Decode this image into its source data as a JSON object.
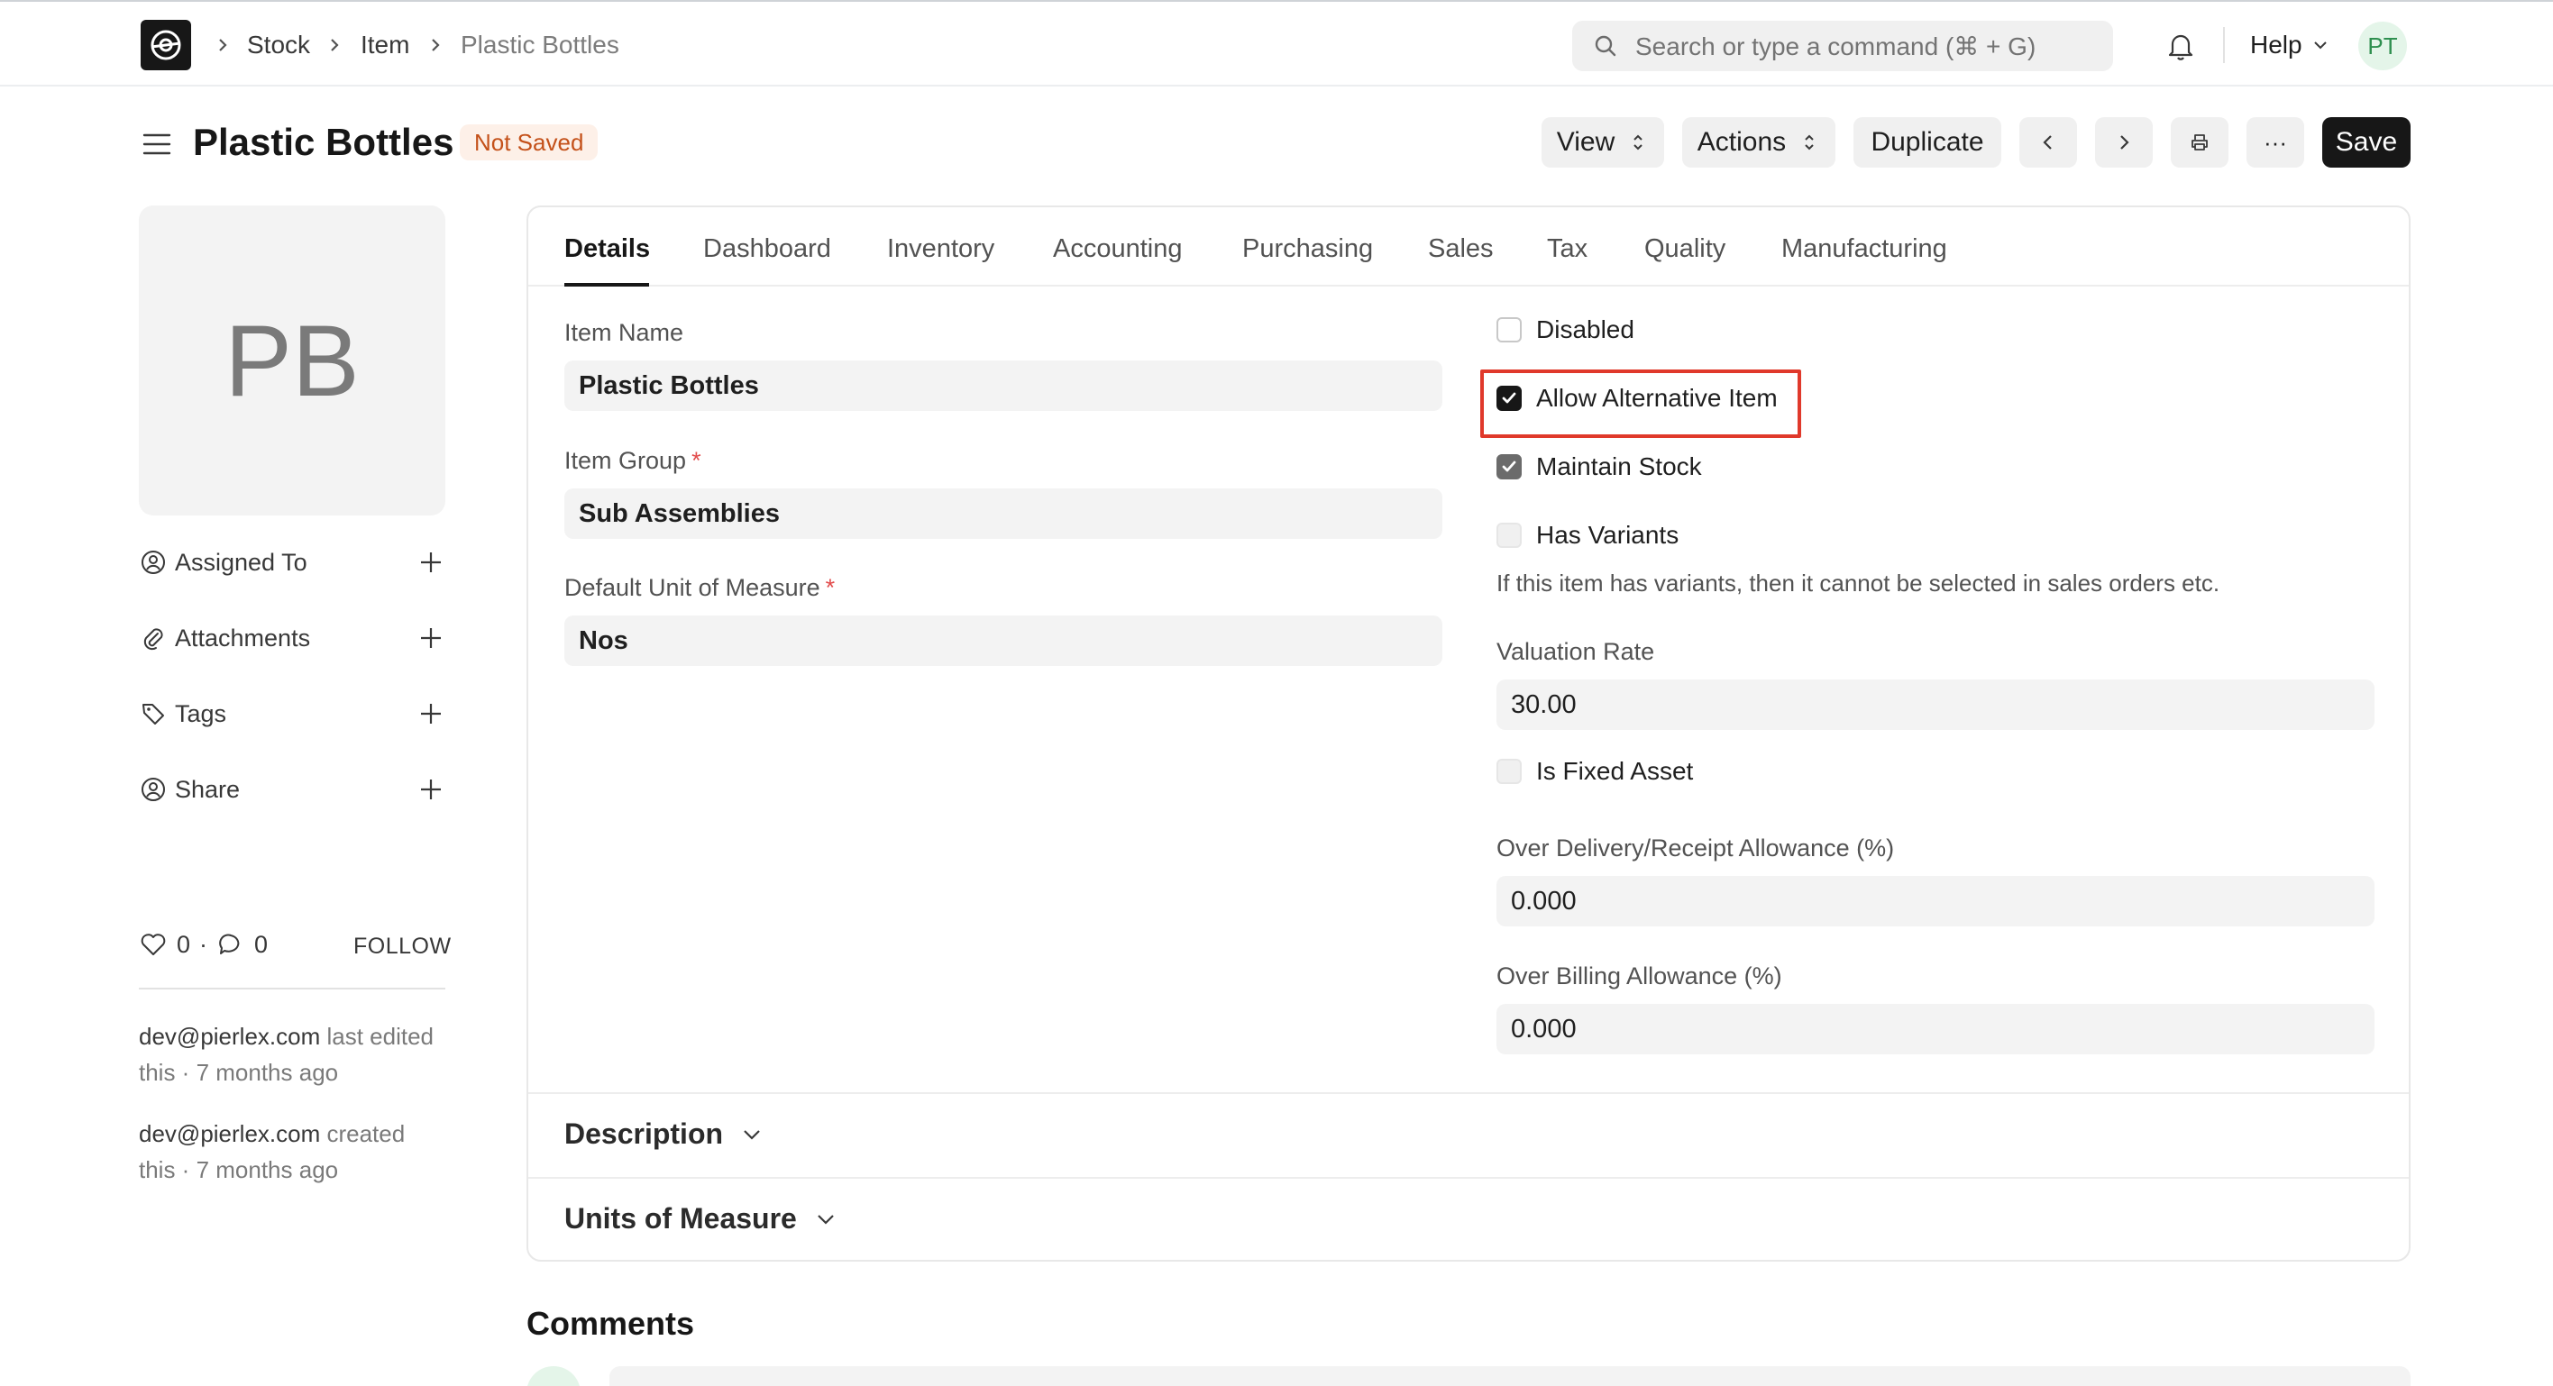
{
  "navbar": {
    "breadcrumbs": [
      "Stock",
      "Item",
      "Plastic Bottles"
    ],
    "search_placeholder": "Search or type a command (⌘ + G)",
    "help_label": "Help",
    "user_initials": "PT"
  },
  "page": {
    "title": "Plastic Bottles",
    "status_badge": "Not Saved",
    "buttons": {
      "view": "View",
      "actions": "Actions",
      "duplicate": "Duplicate",
      "more": "···",
      "save": "Save"
    }
  },
  "sidebar": {
    "avatar_initials": "PB",
    "items": [
      {
        "label": "Assigned To",
        "icon": "assign-icon"
      },
      {
        "label": "Attachments",
        "icon": "paperclip-icon"
      },
      {
        "label": "Tags",
        "icon": "tag-icon"
      },
      {
        "label": "Share",
        "icon": "share-user-icon"
      }
    ],
    "likes_count": "0",
    "comments_count": "0",
    "follow_label": "FOLLOW",
    "activity": [
      {
        "user": "dev@pierlex.com",
        "text": " last edited this · 7 months ago"
      },
      {
        "user": "dev@pierlex.com",
        "text": " created this · 7 months ago"
      }
    ]
  },
  "tabs": [
    "Details",
    "Dashboard",
    "Inventory",
    "Accounting",
    "Purchasing",
    "Sales",
    "Tax",
    "Quality",
    "Manufacturing"
  ],
  "active_tab": "Details",
  "form": {
    "item_name": {
      "label": "Item Name",
      "value": "Plastic Bottles"
    },
    "item_group": {
      "label": "Item Group",
      "required": "*",
      "value": "Sub Assemblies"
    },
    "uom": {
      "label": "Default Unit of Measure",
      "required": "*",
      "value": "Nos"
    },
    "disabled": {
      "label": "Disabled",
      "checked": false
    },
    "allow_alternative_item": {
      "label": "Allow Alternative Item",
      "checked": true
    },
    "maintain_stock": {
      "label": "Maintain Stock",
      "checked": true
    },
    "has_variants": {
      "label": "Has Variants",
      "checked": false,
      "help": "If this item has variants, then it cannot be selected in sales orders etc."
    },
    "valuation_rate": {
      "label": "Valuation Rate",
      "value": "30.00"
    },
    "is_fixed_asset": {
      "label": "Is Fixed Asset",
      "checked": false
    },
    "over_delivery": {
      "label": "Over Delivery/Receipt Allowance (%)",
      "value": "0.000"
    },
    "over_billing": {
      "label": "Over Billing Allowance (%)",
      "value": "0.000"
    }
  },
  "sections": {
    "description": "Description",
    "units_of_measure": "Units of Measure"
  },
  "comments_title": "Comments",
  "colors": {
    "accent": "#171717",
    "highlight": "#e0392b",
    "badge_bg": "#fdf0e8",
    "badge_text": "#c4511a"
  }
}
